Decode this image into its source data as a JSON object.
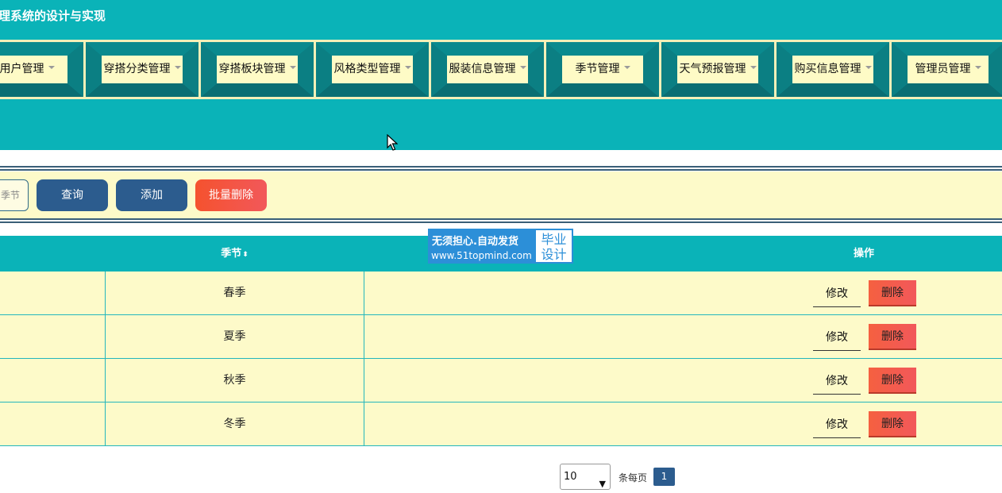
{
  "header": {
    "title": "理系统的设计与实现"
  },
  "nav": {
    "items": [
      {
        "label": "用户管理"
      },
      {
        "label": "穿搭分类管理"
      },
      {
        "label": "穿搭板块管理"
      },
      {
        "label": "风格类型管理"
      },
      {
        "label": "服装信息管理"
      },
      {
        "label": "季节管理"
      },
      {
        "label": "天气预报管理"
      },
      {
        "label": "购买信息管理"
      },
      {
        "label": "管理员管理"
      }
    ]
  },
  "search": {
    "input_placeholder": "季节",
    "query_label": "查询",
    "add_label": "添加",
    "batch_delete_label": "批量删除"
  },
  "table": {
    "columns": {
      "season": "季节",
      "actions": "操作"
    },
    "rows": [
      {
        "season": "春季"
      },
      {
        "season": "夏季"
      },
      {
        "season": "秋季"
      },
      {
        "season": "冬季"
      }
    ],
    "edit_label": "修改",
    "delete_label": "删除"
  },
  "pagination": {
    "page_size": "10",
    "per_page_label": "条每页",
    "current_page": "1"
  },
  "watermark": {
    "line1": "无须担心.自动发货",
    "line2": "www.51topmind.com",
    "badge_top": "毕业",
    "badge_bottom": "设计"
  },
  "colors": {
    "teal": "#0ab3b8",
    "cream": "#fdfac9",
    "blue_button": "#2c5c8e",
    "red_button": "#f5522e"
  }
}
